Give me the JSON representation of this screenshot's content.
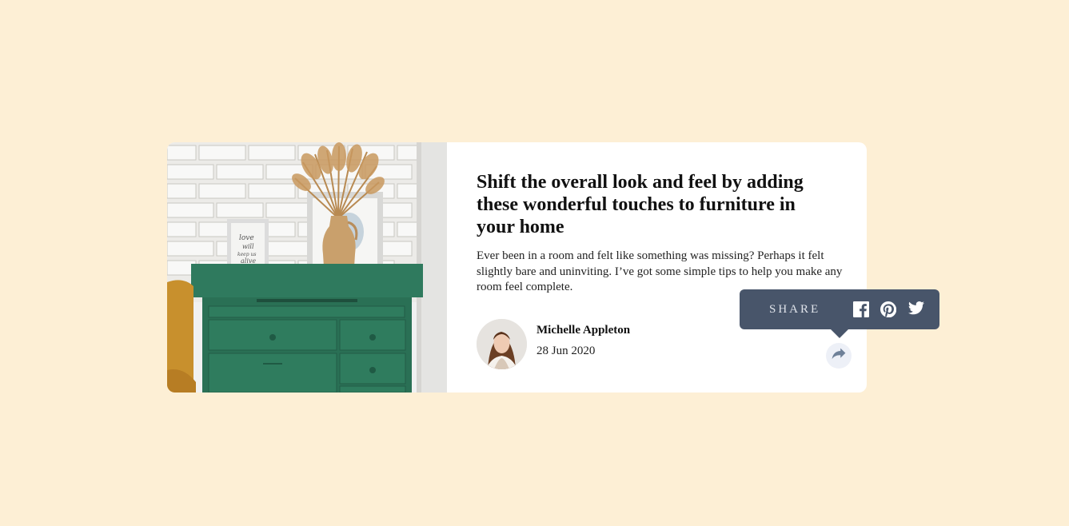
{
  "article": {
    "title": "Shift the overall look and feel by adding these wonderful touches to furniture in your home",
    "description": "Ever been in a room and felt like something was missing? Perhaps it felt slightly bare and uninviting. I’ve got some simple tips to help you make any room feel complete."
  },
  "author": {
    "name": "Michelle Appleton",
    "date": "28 Jun 2020"
  },
  "share": {
    "label": "SHARE",
    "icons": [
      "facebook-icon",
      "pinterest-icon",
      "twitter-icon",
      "share-arrow-icon"
    ]
  },
  "colors": {
    "background": "#fdefd5",
    "tooltip": "#48556a",
    "share_button_bg": "#edf0f7",
    "share_icon": "#6e8098"
  }
}
